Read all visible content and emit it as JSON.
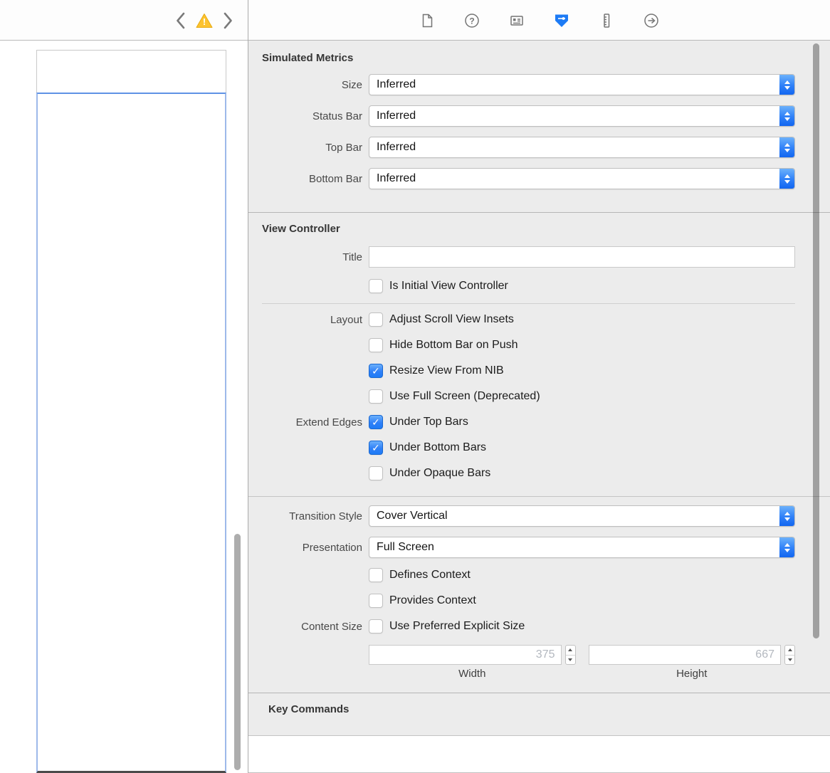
{
  "toolbar": {
    "warning_glyph": "!",
    "help_glyph": "?",
    "icons": [
      "chevron-left",
      "warning-triangle",
      "chevron-right"
    ],
    "tabs": [
      {
        "name": "file-inspector",
        "selected": false
      },
      {
        "name": "quick-help-inspector",
        "selected": false
      },
      {
        "name": "identity-inspector",
        "selected": false
      },
      {
        "name": "attributes-inspector",
        "selected": true
      },
      {
        "name": "size-inspector",
        "selected": false
      },
      {
        "name": "connections-inspector",
        "selected": false
      }
    ]
  },
  "inspector": {
    "simulated_metrics": {
      "title": "Simulated Metrics",
      "rows": [
        {
          "label": "Size",
          "value": "Inferred"
        },
        {
          "label": "Status Bar",
          "value": "Inferred"
        },
        {
          "label": "Top Bar",
          "value": "Inferred"
        },
        {
          "label": "Bottom Bar",
          "value": "Inferred"
        }
      ]
    },
    "view_controller": {
      "title": "View Controller",
      "title_row": {
        "label": "Title",
        "value": ""
      },
      "is_initial": {
        "label": "Is Initial View Controller",
        "checked": false
      },
      "layout_label": "Layout",
      "layout_options": [
        {
          "label": "Adjust Scroll View Insets",
          "checked": false
        },
        {
          "label": "Hide Bottom Bar on Push",
          "checked": false
        },
        {
          "label": "Resize View From NIB",
          "checked": true
        },
        {
          "label": "Use Full Screen (Deprecated)",
          "checked": false
        }
      ],
      "extend_edges_label": "Extend Edges",
      "extend_edges_options": [
        {
          "label": "Under Top Bars",
          "checked": true
        },
        {
          "label": "Under Bottom Bars",
          "checked": true
        },
        {
          "label": "Under Opaque Bars",
          "checked": false
        }
      ],
      "transition_style": {
        "label": "Transition Style",
        "value": "Cover Vertical"
      },
      "presentation": {
        "label": "Presentation",
        "value": "Full Screen"
      },
      "defines_context": {
        "label": "Defines Context",
        "checked": false
      },
      "provides_context": {
        "label": "Provides Context",
        "checked": false
      },
      "content_size": {
        "label": "Content Size",
        "option_label": "Use Preferred Explicit Size",
        "checked": false
      },
      "width_field": {
        "placeholder": "375",
        "label": "Width"
      },
      "height_field": {
        "placeholder": "667",
        "label": "Height"
      }
    },
    "key_commands": {
      "title": "Key Commands"
    }
  },
  "colors": {
    "accent_blue": "#1d7bf5",
    "warning_yellow": "#fdc32f",
    "panel_background": "#ececec"
  }
}
